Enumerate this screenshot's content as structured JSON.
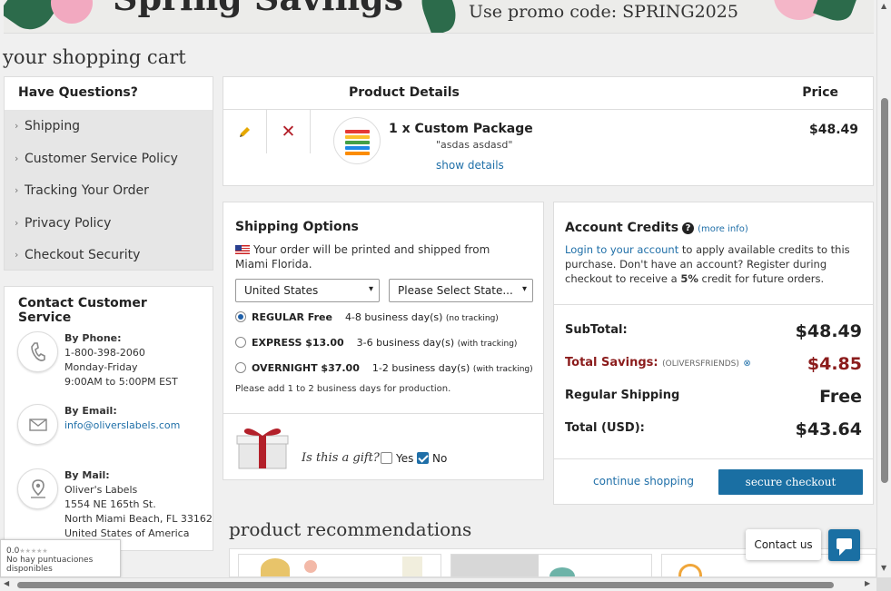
{
  "banner": {
    "headline": "Spring Savings",
    "promo": "Use promo code: SPRING2025"
  },
  "page_title": "your shopping cart",
  "sidebar": {
    "questions_header": "Have Questions?",
    "items": [
      {
        "label": "Shipping"
      },
      {
        "label": "Customer Service Policy"
      },
      {
        "label": "Tracking Your Order"
      },
      {
        "label": "Privacy Policy"
      },
      {
        "label": "Checkout Security"
      }
    ],
    "contact": {
      "header": "Contact Customer Service",
      "phone": {
        "title": "By Phone:",
        "number": "1-800-398-2060",
        "days": "Monday-Friday",
        "hours": "9:00AM to 5:00PM EST"
      },
      "email": {
        "title": "By Email:",
        "address": "info@oliverslabels.com"
      },
      "mail": {
        "title": "By Mail:",
        "line1": "Oliver's Labels",
        "line2": "1554 NE 165th St.",
        "line3": "North Miami Beach, FL 33162",
        "line4": "United States of America"
      }
    }
  },
  "rating_badge": {
    "score": "0.0",
    "text": "No hay puntuaciones disponibles"
  },
  "product": {
    "header_details": "Product Details",
    "header_price": "Price",
    "name": "1 x  Custom Package",
    "subtitle": "\"asdas asdasd\"",
    "show_details": "show details",
    "price": "$48.49"
  },
  "shipping": {
    "title": "Shipping Options",
    "note": "Your order will be printed and shipped from Miami Florida.",
    "country": "United States",
    "state_placeholder": "Please Select State...",
    "options": [
      {
        "name": "REGULAR Free",
        "time": "4-8 business day(s)",
        "tracking": "(no tracking)",
        "selected": true
      },
      {
        "name": "EXPRESS $13.00",
        "time": "3-6 business day(s)",
        "tracking": "(with tracking)",
        "selected": false
      },
      {
        "name": "OVERNIGHT $37.00",
        "time": "1-2 business day(s)",
        "tracking": "(with tracking)",
        "selected": false
      }
    ],
    "production_note": "Please add 1 to 2 business days for production.",
    "gift_question": "Is this a gift?",
    "gift_yes": "Yes",
    "gift_no": "No"
  },
  "credits": {
    "title": "Account Credits",
    "more_info": "(more info)",
    "login_link": "Login to your account",
    "text_after_link": " to apply available credits to this purchase. Don't have an account? Register during checkout to receive a ",
    "percent": "5%",
    "text_end": " credit for future orders."
  },
  "totals": {
    "subtotal_label": "SubTotal:",
    "subtotal": "$48.49",
    "savings_label": "Total Savings:",
    "savings_code": "(OLIVERSFRIENDS)",
    "savings": "$4.85",
    "shipping_label": "Regular Shipping",
    "shipping": "Free",
    "total_label": "Total (USD):",
    "total": "$43.64"
  },
  "actions": {
    "continue_shopping": "continue shopping",
    "secure_checkout": "secure checkout"
  },
  "recommendations_title": "product recommendations",
  "chat": {
    "contact_us": "Contact us"
  },
  "colors": {
    "accent": "#1a6fa3",
    "savings": "#8b1c1c",
    "link": "#1f6fa8"
  }
}
